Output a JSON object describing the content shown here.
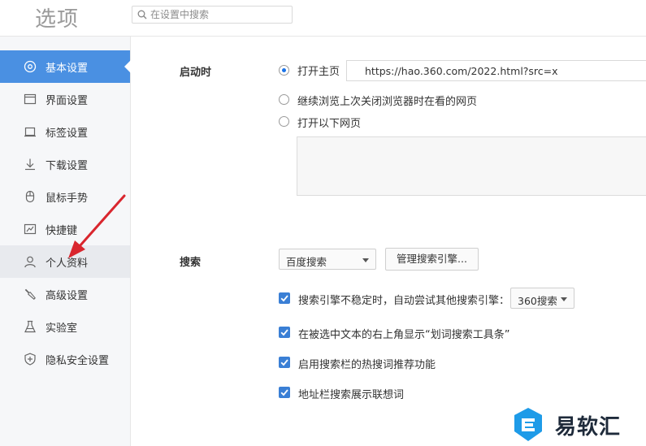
{
  "header": {
    "title": "选项",
    "search_placeholder": "在设置中搜索"
  },
  "sidebar": {
    "items": [
      {
        "label": "基本设置",
        "icon": "circle-settings-icon"
      },
      {
        "label": "界面设置",
        "icon": "window-icon"
      },
      {
        "label": "标签设置",
        "icon": "tab-icon"
      },
      {
        "label": "下载设置",
        "icon": "download-icon"
      },
      {
        "label": "鼠标手势",
        "icon": "mouse-icon"
      },
      {
        "label": "快捷键",
        "icon": "keyboard-icon"
      },
      {
        "label": "个人资料",
        "icon": "user-icon"
      },
      {
        "label": "高级设置",
        "icon": "wrench-icon"
      },
      {
        "label": "实验室",
        "icon": "flask-icon"
      },
      {
        "label": "隐私安全设置",
        "icon": "shield-icon"
      }
    ],
    "active_index": 0,
    "hover_index": 6
  },
  "startup": {
    "label": "启动时",
    "options": [
      {
        "label": "打开主页",
        "checked": true
      },
      {
        "label": "继续浏览上次关闭浏览器时在看的网页",
        "checked": false
      },
      {
        "label": "打开以下网页",
        "checked": false
      }
    ],
    "homepage_url": "https://hao.360.com/2022.html?src=x"
  },
  "search": {
    "label": "搜索",
    "engine_selected": "百度搜索",
    "manage_button": "管理搜索引擎...",
    "options": [
      {
        "label": "搜索引擎不稳定时，自动尝试其他搜索引擎：",
        "checked": true
      },
      {
        "label": "在被选中文本的右上角显示“划词搜索工具条”",
        "checked": true
      },
      {
        "label": "启用搜索栏的热搜词推荐功能",
        "checked": true
      },
      {
        "label": "地址栏搜索展示联想词",
        "checked": true
      }
    ],
    "fallback_engine": "360搜索"
  },
  "watermark": {
    "text": "易软汇"
  },
  "colors": {
    "accent": "#4a90e2",
    "checkbox": "#3a7fd5",
    "annotation_arrow": "#d9262e"
  }
}
